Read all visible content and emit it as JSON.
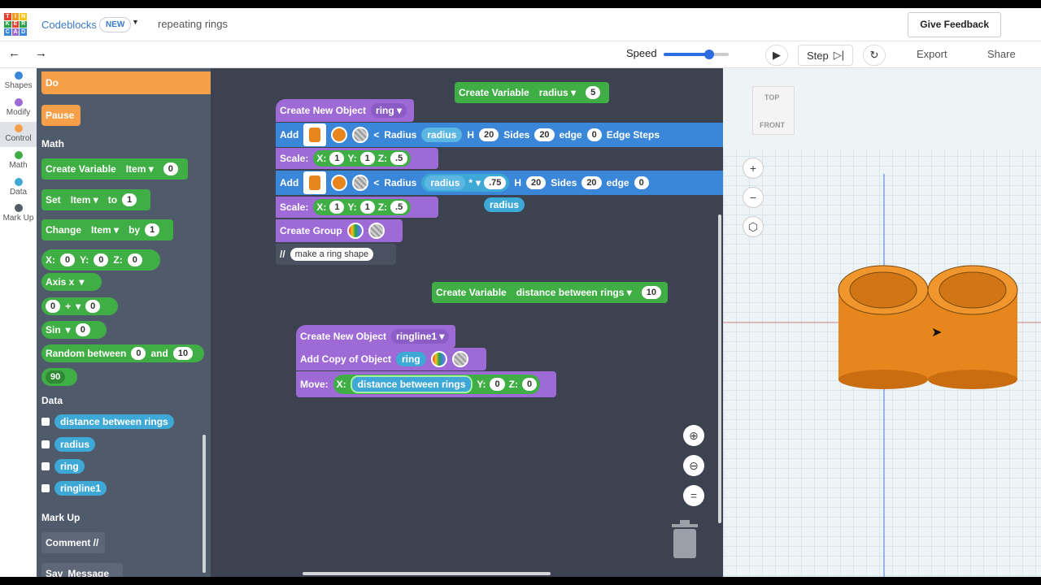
{
  "logo": {
    "letters": [
      "T",
      "I",
      "N",
      "K",
      "E",
      "R",
      "C",
      "A",
      "D"
    ],
    "colors": [
      "#e8402f",
      "#f49a1b",
      "#f8c517",
      "#2aa04a",
      "#e8402f",
      "#2aa04a",
      "#3a86d8",
      "#9d6ad6",
      "#3a86d8"
    ]
  },
  "header": {
    "app_name": "Codeblocks",
    "badge": "NEW",
    "project_name": "repeating rings",
    "feedback_label": "Give Feedback"
  },
  "toolbar": {
    "speed_label": "Speed",
    "speed": 0.7,
    "step_label": "Step",
    "export_label": "Export",
    "share_label": "Share"
  },
  "categories": [
    {
      "label": "Shapes",
      "color": "#3a86d8"
    },
    {
      "label": "Modify",
      "color": "#9d6ad6"
    },
    {
      "label": "Control",
      "color": "#f5a049"
    },
    {
      "label": "Math",
      "color": "#3fae44"
    },
    {
      "label": "Data",
      "color": "#3ea8d6"
    },
    {
      "label": "Mark Up",
      "color": "#555c66"
    }
  ],
  "palette": {
    "control": {
      "do_label": "Do",
      "pause_label": "Pause"
    },
    "math_title": "Math",
    "create_variable": {
      "label": "Create Variable",
      "var": "Item",
      "value": "0"
    },
    "set": {
      "label": "Set",
      "var": "Item",
      "to": "to",
      "value": "1"
    },
    "change": {
      "label": "Change",
      "var": "Item",
      "by": "by",
      "value": "1"
    },
    "xyz": {
      "x": "X:",
      "x_val": "0",
      "y": "Y:",
      "y_val": "0",
      "z": "Z:",
      "z_val": "0"
    },
    "axis": {
      "label": "Axis x"
    },
    "op": {
      "a": "0",
      "op": "+",
      "b": "0"
    },
    "sin": {
      "label": "Sin",
      "value": "0"
    },
    "random": {
      "label": "Random between",
      "a": "0",
      "and": "and",
      "b": "10"
    },
    "number": "90",
    "data_title": "Data",
    "data_vars": [
      "distance between rings",
      "radius",
      "ring",
      "ringline1"
    ],
    "markup_title": "Mark Up",
    "comment_label": "Comment //",
    "say_label": "Say",
    "message_label": "Message"
  },
  "workspace": {
    "create_var_radius": {
      "label": "Create Variable",
      "var": "radius",
      "value": "5"
    },
    "create_obj_ring": {
      "label": "Create New Object",
      "name": "ring"
    },
    "add1": {
      "label": "Add",
      "radius_label": "Radius",
      "radius_var": "radius",
      "h_label": "H",
      "h": "20",
      "sides_label": "Sides",
      "sides": "20",
      "edge_label": "edge",
      "edge": "0",
      "edge_steps_label": "Edge Steps"
    },
    "scale1": {
      "label": "Scale:",
      "x": "X:",
      "x_val": "1",
      "y": "Y:",
      "y_val": "1",
      "z": "Z:",
      "z_val": ".5"
    },
    "add2": {
      "label": "Add",
      "radius_label": "Radius",
      "radius_var": "radius",
      "op": "*",
      "factor": ".75",
      "h_label": "H",
      "h": "20",
      "sides_label": "Sides",
      "sides": "20",
      "edge_label": "edge",
      "edge": "0",
      "floating_var": "radius"
    },
    "scale2": {
      "label": "Scale:",
      "x": "X:",
      "x_val": "1",
      "y": "Y:",
      "y_val": "1",
      "z": "Z:",
      "z_val": ".5"
    },
    "create_group": {
      "label": "Create Group"
    },
    "comment": {
      "marker": "//",
      "text": "make a ring shape"
    },
    "create_var_dist": {
      "label": "Create Variable",
      "var": "distance between rings",
      "value": "10"
    },
    "create_obj_line": {
      "label": "Create New Object",
      "name": "ringline1"
    },
    "add_copy": {
      "label": "Add Copy of Object",
      "name": "ring"
    },
    "move": {
      "label": "Move:",
      "x": "X:",
      "x_var": "distance between rings",
      "y": "Y:",
      "y_val": "0",
      "z": "Z:",
      "z_val": "0"
    }
  },
  "viewcube": {
    "top": "TOP",
    "front": "FRONT"
  },
  "colors": {
    "accent": "#2c6be0",
    "ring": "#e8861e"
  }
}
